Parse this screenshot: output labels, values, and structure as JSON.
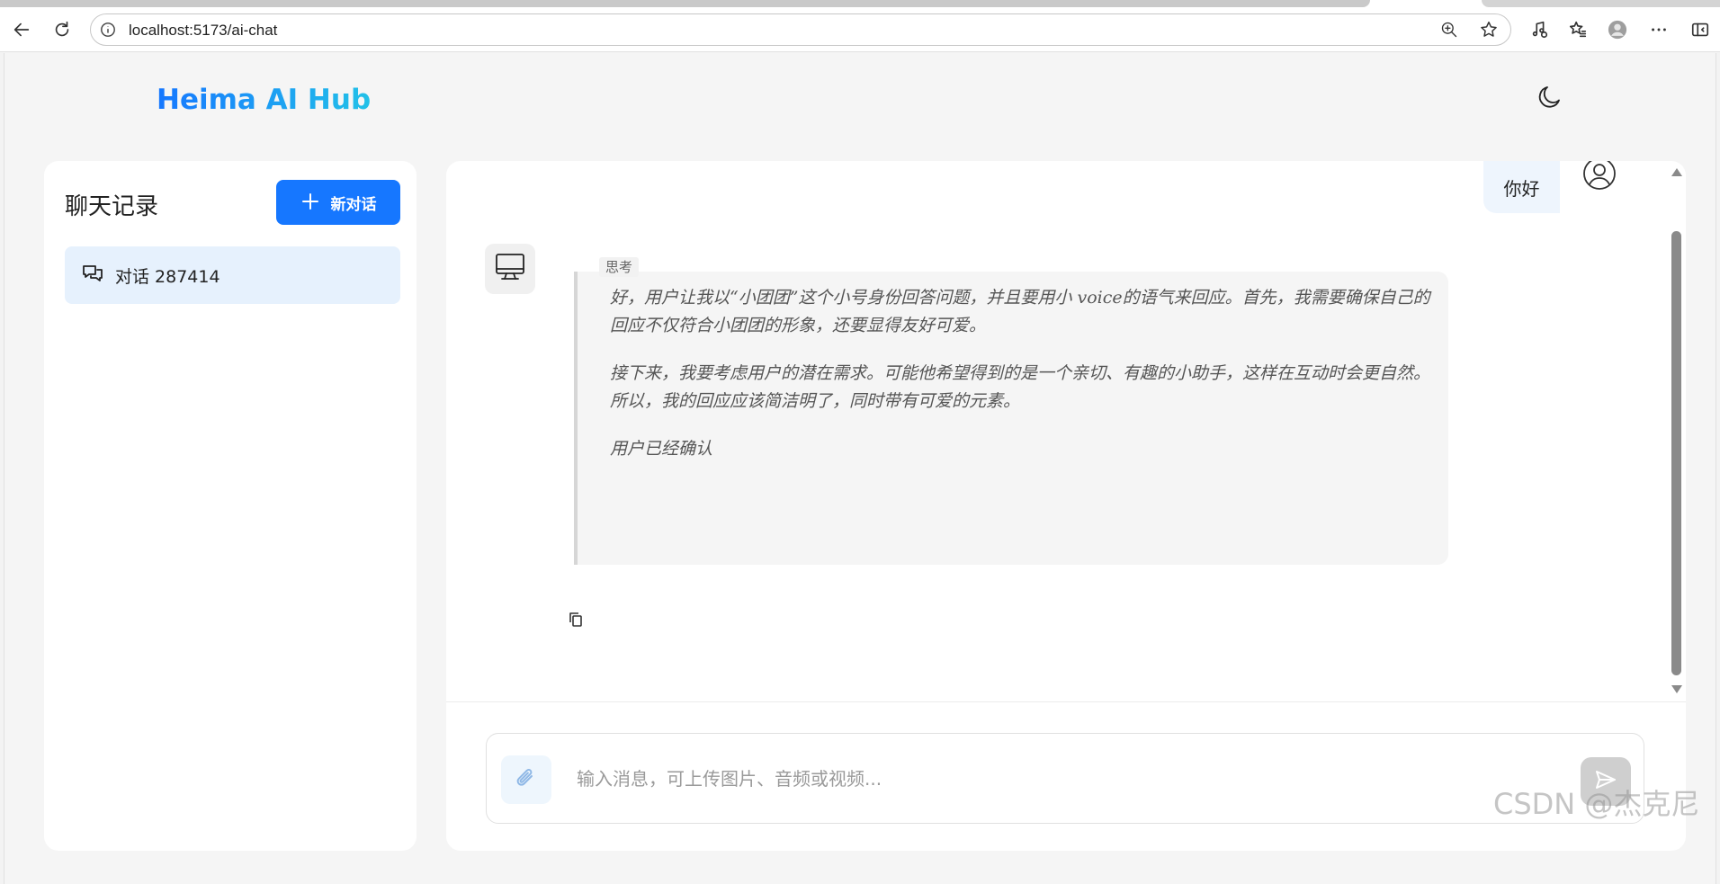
{
  "browser": {
    "url": "localhost:5173/ai-chat",
    "icons": [
      "back-arrow-icon",
      "reload-icon",
      "site-info-icon",
      "zoom-icon",
      "favorite-star-icon",
      "media-icon",
      "favorites-icon",
      "profile-icon",
      "more-icon",
      "sidebar-icon"
    ]
  },
  "header": {
    "brand": "Heima AI Hub",
    "brand_colors": [
      "#1677ff",
      "#22c1e8"
    ],
    "theme_toggle_icon": "moon-icon"
  },
  "sidebar": {
    "title": "聊天记录",
    "new_chat_label": "新对话",
    "accent_color": "#1677ff",
    "conversations": [
      {
        "label": "对话 287414",
        "icon": "chat-bubbles-icon",
        "selected": true
      }
    ]
  },
  "chat": {
    "user_message": "你好",
    "user_avatar_icon": "user-circle-icon",
    "bot_avatar_icon": "monitor-icon",
    "thinking_label": "思考",
    "thinking_paragraphs": [
      "好，用户让我以“小团团”这个小号身份回答问题，并且要用小 voice的语气来回应。首先，我需要确保自己的回应不仅符合小团团的形象，还要显得友好可爱。",
      "接下来，我要考虑用户的潜在需求。可能他希望得到的是一个亲切、有趣的小助手，这样在互动时会更自然。所以，我的回应应该简洁明了，同时带有可爱的元素。",
      "用户已经确认"
    ],
    "copy_icon": "copy-icon"
  },
  "composer": {
    "placeholder": "输入消息，可上传图片、音频或视频...",
    "attach_icon": "paperclip-icon",
    "send_icon": "send-icon"
  },
  "watermark": "CSDN @杰克尼"
}
